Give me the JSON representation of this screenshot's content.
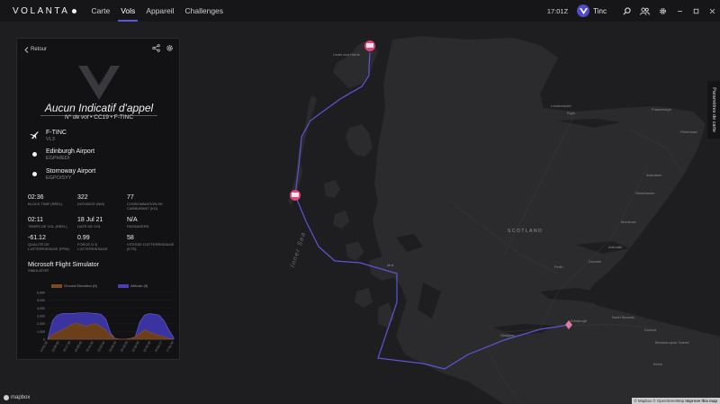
{
  "app": {
    "logo": "VOLANTA",
    "nav": [
      "Carte",
      "Vols",
      "Appareil",
      "Challenges"
    ],
    "active_nav": "Vols",
    "clock": "17:01Z",
    "user": "Tinc"
  },
  "map": {
    "side_tab": "Paramètres de carte",
    "sea_label": "Inner Sea",
    "region_label": "SCOTLAND",
    "labels": [
      {
        "text": "Lewis and Harris",
        "cls": "o"
      },
      {
        "text": "Lossiemouth",
        "cls": "o"
      },
      {
        "text": "Elgin",
        "cls": "o"
      },
      {
        "text": "Fraserburgh",
        "cls": "o"
      },
      {
        "text": "Peterhead",
        "cls": "o"
      },
      {
        "text": "Aberdeen",
        "cls": "o"
      },
      {
        "text": "Stonehaven",
        "cls": "o"
      },
      {
        "text": "Montrose",
        "cls": "o"
      },
      {
        "text": "Arbroath",
        "cls": "o"
      },
      {
        "text": "Dundee",
        "cls": "o"
      },
      {
        "text": "Perth",
        "cls": "o"
      },
      {
        "text": "Mull",
        "cls": "o"
      },
      {
        "text": "Glasgow",
        "cls": "o"
      },
      {
        "text": "Edinburgh",
        "cls": "o"
      },
      {
        "text": "North Berwick",
        "cls": "o"
      },
      {
        "text": "Dunbar",
        "cls": "o"
      },
      {
        "text": "Kelso",
        "cls": "o"
      },
      {
        "text": "Berwick-upon-Tweed",
        "cls": "o"
      }
    ],
    "mapbox": "mapbox",
    "attribution_prefix": "© Mapbox © OpenStreetMap",
    "attribution_link": "Improve this map"
  },
  "panel": {
    "back": "Retour",
    "callsign": "Aucun Indicatif d'appel",
    "flight_label": "N° de vol",
    "flight_sep": " • CC19 • F-TINC",
    "aircraft": {
      "title": "F-TINC",
      "sub": "VL3"
    },
    "origin": {
      "title": "Edinburgh Airport",
      "sub": "EGPH/EDI"
    },
    "destination": {
      "title": "Stornoway Airport",
      "sub": "EGPO/SYY"
    },
    "stats": [
      [
        {
          "v": "02:36",
          "l": "BLOCK TIME (RÉEL)"
        },
        {
          "v": "322",
          "l": "DISTANCE (NM)"
        },
        {
          "v": "77",
          "l": "CONSOMMATION DE CARBURANT (KG)"
        }
      ],
      [
        {
          "v": "02:11",
          "l": "TEMPS DE VOL (RÉEL)"
        },
        {
          "v": "18 Jul 21",
          "l": "DATE DE VOL"
        },
        {
          "v": "N/A",
          "l": "PASSAGERS"
        }
      ],
      [
        {
          "v": "-61.12",
          "l": "QUALITÉ DE L'ATTERRISSAGE (FPM)"
        },
        {
          "v": "0.99",
          "l": "FORCE G À L'ATTERRISSAGE"
        },
        {
          "v": "58",
          "l": "VITESSE D'ATTERRISSAGE (KTS)"
        }
      ]
    ],
    "simulator": {
      "value": "Microsoft Flight Simulator",
      "label": "SIMULATOR"
    }
  },
  "chart_data": {
    "type": "area",
    "series": [
      {
        "name": "Ground Elevation (ft)",
        "color": "#7a4a20"
      },
      {
        "name": "Altitude (ft)",
        "color": "#4a3fb5"
      }
    ],
    "ylim": [
      0,
      6000
    ],
    "y_ticks": [
      "6,000",
      "5,000",
      "4,000",
      "3,000",
      "2,000",
      "1,000",
      "0"
    ],
    "x_ticks": [
      "14:51:32",
      "15:05:50",
      "15:17:33",
      "15:29:42",
      "15:41:52",
      "15:53:44",
      "16:06:25",
      "16:18:26",
      "16:30:35",
      "16:42:25",
      "16:54:17",
      "17:01:42"
    ],
    "altitude": [
      0,
      2400,
      3100,
      3300,
      3300,
      3300,
      3350,
      3400,
      3400,
      3350,
      3300,
      3200,
      2600,
      800,
      0,
      0,
      0,
      0,
      200,
      2200,
      3100,
      3300,
      3200,
      3100,
      2400,
      1200,
      200
    ],
    "ground": [
      0,
      600,
      900,
      1200,
      1500,
      1900,
      2100,
      1800,
      1700,
      1900,
      2000,
      1600,
      1200,
      500,
      100,
      0,
      0,
      100,
      300,
      700,
      1200,
      900,
      700,
      500,
      300,
      100,
      0
    ]
  },
  "colors": {
    "accent": "#5a58d6",
    "route": "#5b55d8",
    "pin": "#e0457a"
  }
}
